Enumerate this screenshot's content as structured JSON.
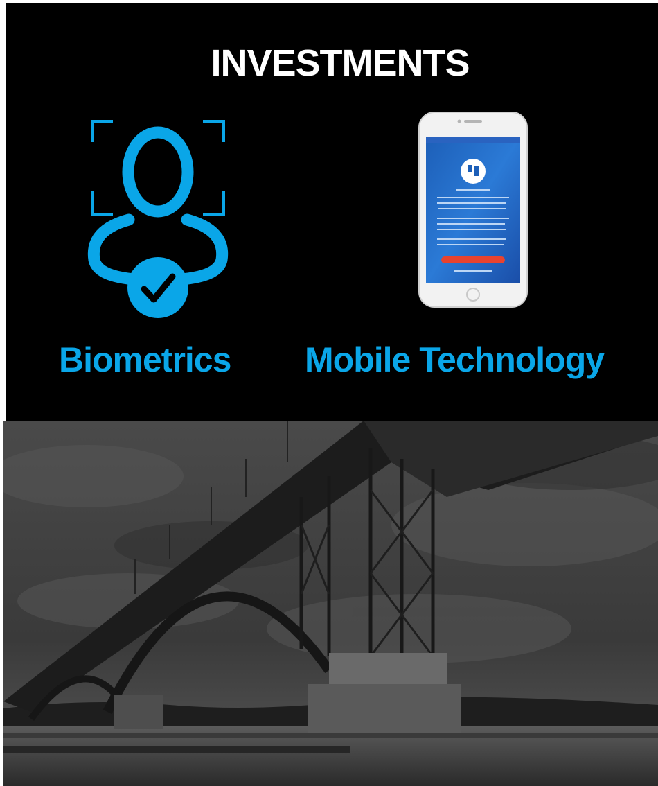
{
  "heading": "INVESTMENTS",
  "items": [
    {
      "label": "Biometrics",
      "icon": "face-scan-check-icon"
    },
    {
      "label": "Mobile Technology",
      "icon": "smartphone-app-icon"
    }
  ],
  "photo": {
    "subject": "steel-arch-bridge-over-river",
    "tone": "grayscale"
  },
  "colors": {
    "accent": "#0aa6e8",
    "panel": "#000000",
    "heading": "#ffffff"
  }
}
